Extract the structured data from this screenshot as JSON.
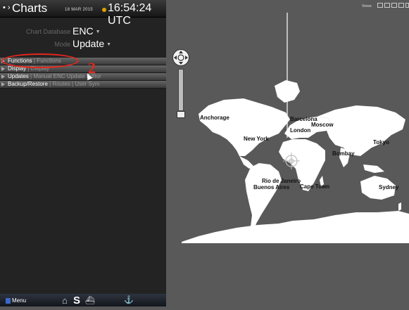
{
  "header": {
    "title": "Charts",
    "date": "18 MAR 2015",
    "time": "16:54:24 UTC"
  },
  "fields": {
    "chart_database_label": "Chart Database",
    "chart_database_value": "ENC",
    "mode_label": "Mode",
    "mode_value": "Update"
  },
  "menu": [
    {
      "primary": "Functions",
      "sep": " | ",
      "secondary": "Functions"
    },
    {
      "primary": "Display",
      "sep": " | ",
      "secondary": "Display"
    },
    {
      "primary": "Updates",
      "sep": " | ",
      "secondary": "Manual ENC Update Editor"
    },
    {
      "primary": "Backup/Restore",
      "sep": " | ",
      "secondary": "Routes | User Sym"
    }
  ],
  "annotation": {
    "number": "2",
    "color": "#e8261c"
  },
  "bottom_bar": {
    "menu_label": "Menu",
    "home_icon": "home-icon",
    "s_label": "S"
  },
  "map": {
    "views_label": "Views:",
    "cities": [
      "Anchorage",
      "London",
      "Moscow",
      "Barcelona",
      "New York",
      "Bombay",
      "Tokyo",
      "Rio de Janeiro",
      "Buenos Aires",
      "Cape Town",
      "Sydney"
    ]
  },
  "colors": {
    "panel": "#232323",
    "map_background": "#595959",
    "land": "#ffffff"
  }
}
